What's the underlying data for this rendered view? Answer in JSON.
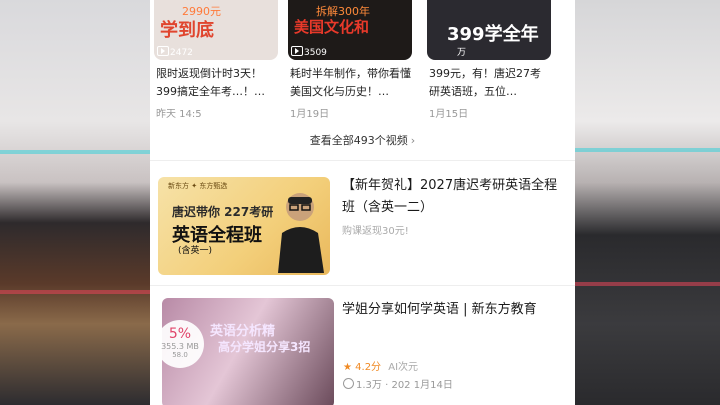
{
  "top_videos": [
    {
      "thumb_big": "学到底",
      "thumb_small": "2990元",
      "views": "2472",
      "title": "限时返现倒计时3天！399搞定全年考…！…",
      "date": "昨天 14:5",
      "bg": "#e8e0dc"
    },
    {
      "thumb_big": "美国文化和",
      "thumb_small": "拆解300年",
      "views": "3509",
      "title": "耗时半年制作，带你看懂美国文化与历史！…",
      "date": "1月19日",
      "bg": "#1e1a18"
    },
    {
      "thumb_big": "399学全年",
      "thumb_small": "",
      "views": "万",
      "title": "399元，有！唐迟27考研英语班，五位…",
      "date": "1月15日",
      "bg": "#2b2a30"
    }
  ],
  "view_all": {
    "label": "查看全部493个视频",
    "chevron": "›"
  },
  "course": {
    "title": "【新年贺礼】2027唐迟考研英语全程班（含英一二）",
    "subtitle": "购课返现30元!",
    "thumb_tag": "新东方 ✦ 东方甄选",
    "thumb_line1": "唐迟带你 227考研",
    "thumb_big": "英语全程班",
    "thumb_sub": "(含英一)"
  },
  "video2": {
    "title": "学姐分享如何学英语 | 新东方教育",
    "overlay1": "英语分析精",
    "overlay2": "高分学姐分享3招",
    "progress_pct": "5%",
    "progress_size": "355.3 MB",
    "progress_speed": "58.0",
    "rating": "4.2分",
    "author": "AI次元",
    "views": "1.3万",
    "date_partial": "· 202",
    "date": "1月14日"
  },
  "colors": {
    "accent": "#e0452e",
    "rating": "#f08a24",
    "progress": "#e0456a",
    "muted": "#999999"
  }
}
